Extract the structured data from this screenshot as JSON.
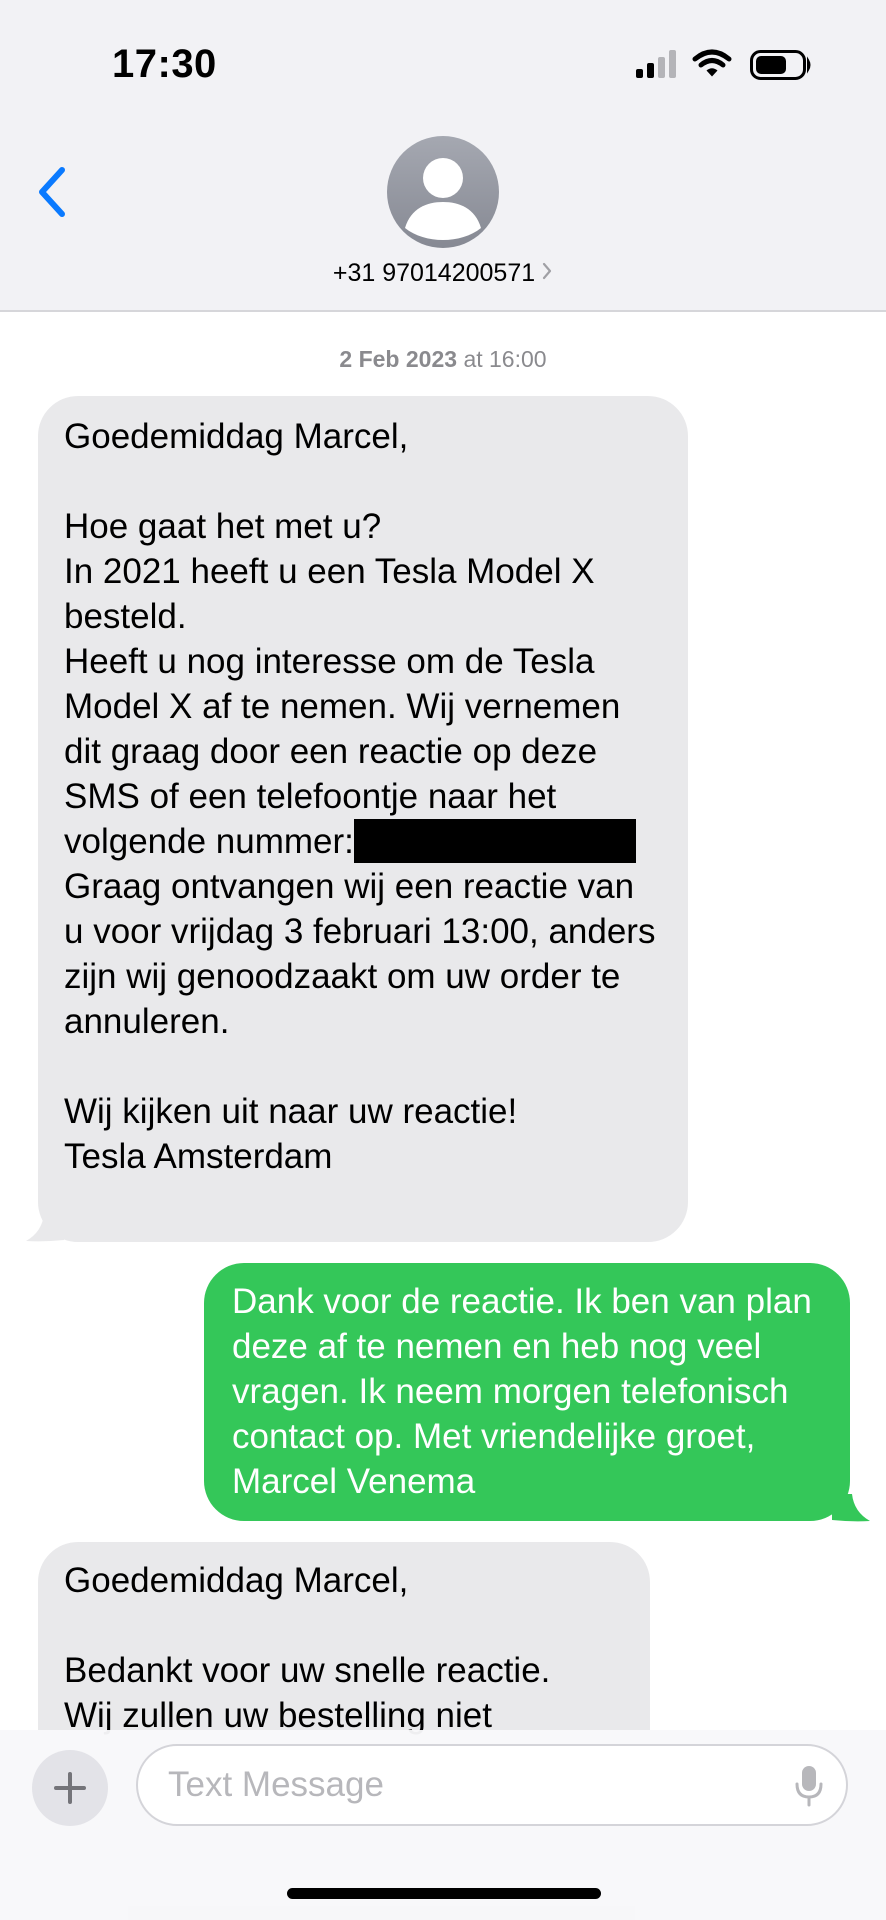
{
  "status_bar": {
    "time": "17:30",
    "signal_icon": "cellular-signal-icon",
    "wifi_icon": "wifi-icon",
    "battery_icon": "battery-icon"
  },
  "header": {
    "back_icon": "chevron-left-icon",
    "avatar_icon": "person-silhouette-icon",
    "contact_number": "+31 97014200571",
    "contact_chevron_icon": "chevron-right-icon"
  },
  "conversation": {
    "timestamp_date": "2 Feb 2023",
    "timestamp_connector": "at",
    "timestamp_time": "16:00",
    "messages": [
      {
        "direction": "incoming",
        "text_before_redaction": "Goedemiddag Marcel,\n\nHoe gaat het met u?\nIn 2021 heeft u een Tesla Model X besteld.\nHeeft u nog interesse om de Tesla Model X af te nemen. Wij vernemen dit graag door een reactie op deze SMS of een telefoontje naar het volgende nummer:",
        "text_after_redaction": "\nGraag ontvangen wij een reactie van u voor vrijdag 3 februari 13:00, anders zijn wij genoodzaakt om uw order te annuleren.\n\nWij kijken uit naar uw reactie!\nTesla Amsterdam"
      },
      {
        "direction": "outgoing",
        "text": "Dank voor de reactie. Ik ben van plan deze af te nemen en heb nog veel vragen. Ik neem morgen telefonisch contact op. Met vriendelijke groet, Marcel Venema"
      },
      {
        "direction": "incoming",
        "text": "Goedemiddag Marcel,\n\nBedankt voor uw snelle reactie.\nWij zullen uw bestelling niet"
      }
    ]
  },
  "input_bar": {
    "plus_icon": "plus-icon",
    "placeholder": "Text Message",
    "mic_icon": "microphone-icon"
  },
  "colors": {
    "incoming_bubble": "#e9e9eb",
    "outgoing_bubble": "#34c759",
    "accent_blue": "#0a7aff",
    "header_background": "#f2f2f5"
  }
}
